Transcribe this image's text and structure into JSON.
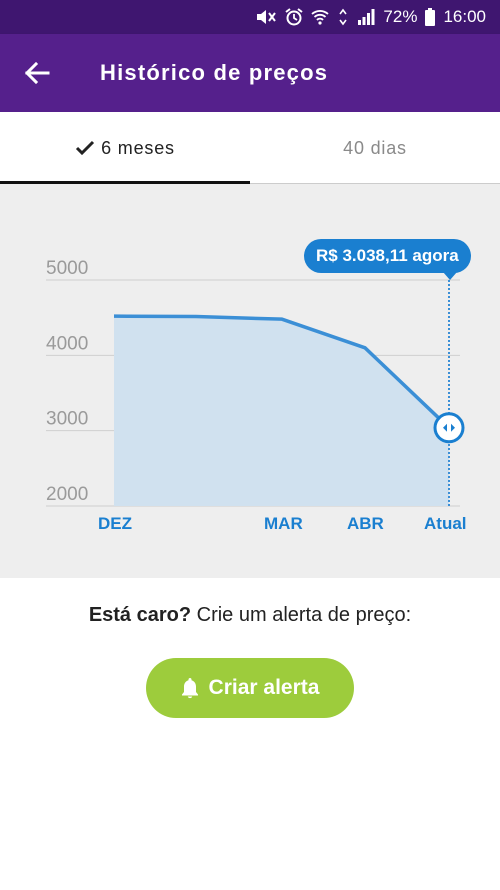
{
  "status_bar": {
    "battery": "72%",
    "time": "16:00"
  },
  "header": {
    "title": "Histórico de preços"
  },
  "tabs": [
    {
      "label": "6 meses",
      "active": true
    },
    {
      "label": "40 dias",
      "active": false
    }
  ],
  "chart_data": {
    "type": "area",
    "x_labels": [
      "DEZ",
      "MAR",
      "ABR",
      "Atual"
    ],
    "y_ticks": [
      5000,
      4000,
      3000,
      2000
    ],
    "ylim": [
      2000,
      5000
    ],
    "points": [
      {
        "x": "DEZ",
        "y": 4520
      },
      {
        "x": "",
        "y": 4515
      },
      {
        "x": "MAR",
        "y": 4480
      },
      {
        "x": "ABR",
        "y": 4100
      },
      {
        "x": "Atual",
        "y": 3038.11
      }
    ],
    "tooltip": "R$ 3.038,11 agora",
    "color": "#3b8fd6"
  },
  "alert_prompt": {
    "bold": "Está caro?",
    "rest": " Crie um alerta de preço:"
  },
  "alert_button": {
    "label": "Criar alerta"
  }
}
